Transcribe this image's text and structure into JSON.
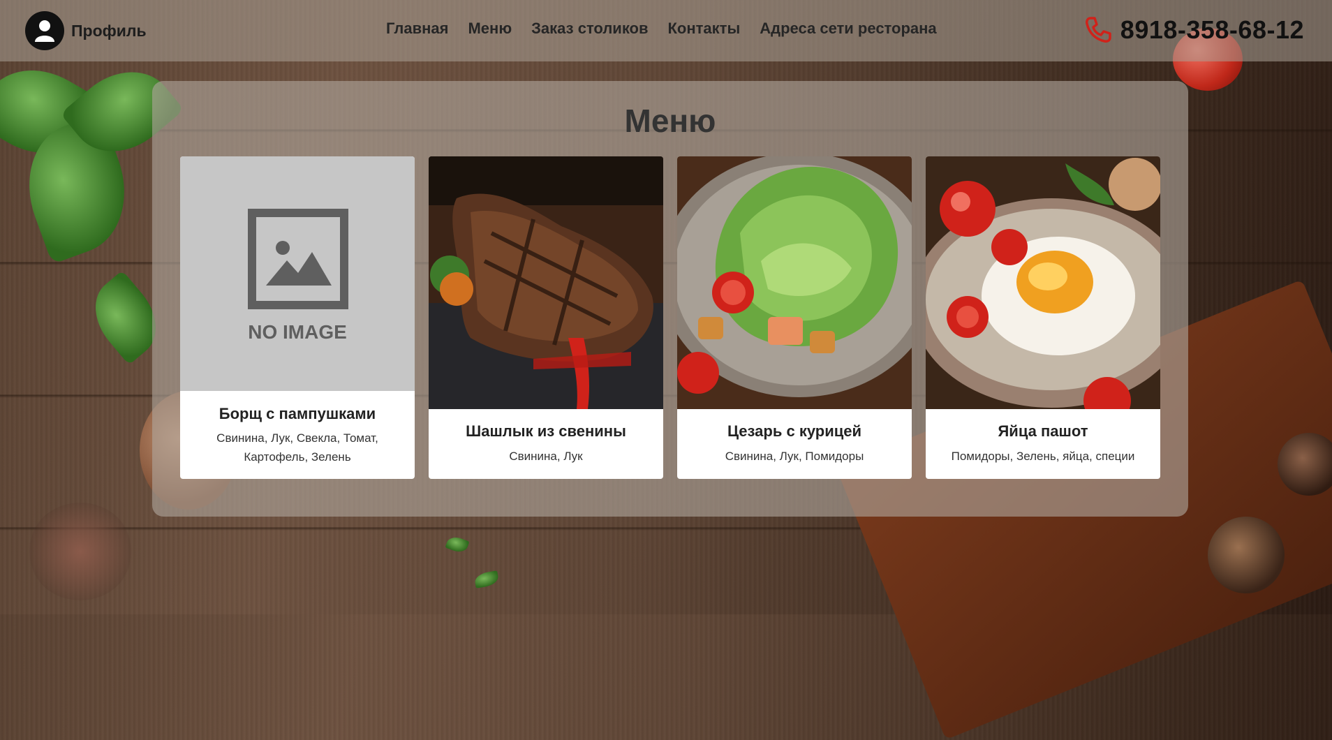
{
  "header": {
    "profile_label": "Профиль",
    "nav": [
      "Главная",
      "Меню",
      "Заказ столиков",
      "Контакты",
      "Адреса сети ресторана"
    ],
    "phone": "8918-358-68-12"
  },
  "menu": {
    "title": "Меню",
    "items": [
      {
        "title": "Борщ с пампушками",
        "description": "Свинина, Лук, Свекла, Томат, Картофель, Зелень",
        "image": "no-image-placeholder",
        "image_text": "NO IMAGE"
      },
      {
        "title": "Шашлык из свенины",
        "description": "Свинина, Лук",
        "image": "grilled-steak-photo"
      },
      {
        "title": "Цезарь с курицей",
        "description": "Свинина, Лук, Помидоры",
        "image": "caesar-salad-photo"
      },
      {
        "title": "Яйца пашот",
        "description": "Помидоры, Зелень, яйца, специи",
        "image": "poached-egg-photo"
      }
    ]
  },
  "icons": {
    "profile": "user-icon",
    "phone": "phone-icon"
  },
  "colors": {
    "phone_icon": "#d0221a",
    "header_bg": "rgba(170,160,150,0.55)",
    "panel_bg": "rgba(175,165,155,0.62)"
  }
}
